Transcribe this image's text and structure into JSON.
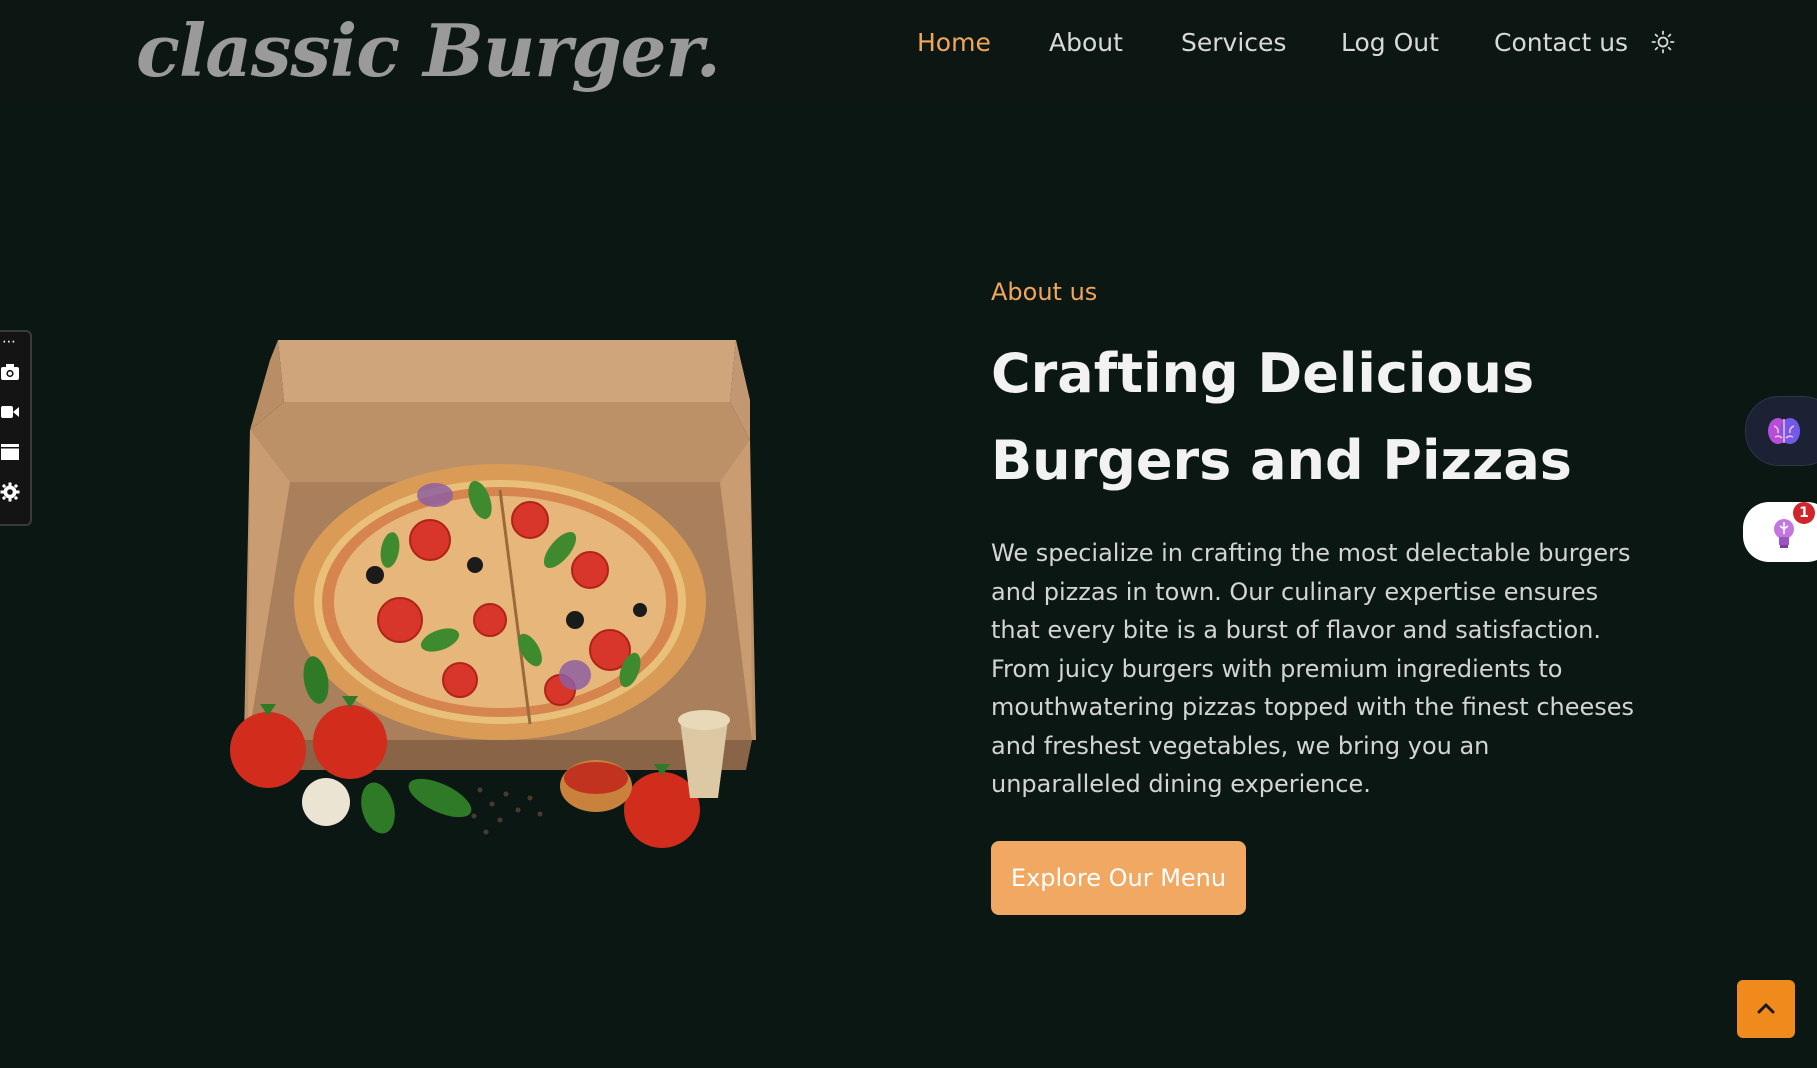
{
  "header": {
    "logo": "classic Burger.",
    "nav": [
      {
        "label": "Home",
        "active": true
      },
      {
        "label": "About",
        "active": false
      },
      {
        "label": "Services",
        "active": false
      },
      {
        "label": "Log Out",
        "active": false
      },
      {
        "label": "Contact us",
        "active": false
      }
    ],
    "theme_icon": "sun-icon"
  },
  "toolbar": {
    "overflow": "⋯",
    "icons": [
      "camera-icon",
      "video-icon",
      "window-icon",
      "gear-icon"
    ]
  },
  "hero": {
    "kicker": "About us",
    "headline_line1": "Crafting Delicious",
    "headline_line2": "Burgers and Pizzas",
    "paragraph": "We specialize in crafting the most delectable burgers and pizzas in town. Our culinary expertise ensures that every bite is a burst of flavor and satisfaction. From juicy burgers with premium ingredients to mouthwatering pizzas topped with the finest cheeses and freshest vegetables, we bring you an unparalleled dining experience.",
    "cta_label": "Explore Our Menu"
  },
  "widgets": {
    "brain_icon": "brain-icon",
    "idea_icon": "lightbulb-icon",
    "idea_badge": "1",
    "back_to_top_icon": "chevron-up-icon"
  },
  "colors": {
    "background": "#0a1713",
    "accent": "#f2a65a",
    "button": "#f0a862",
    "back_to_top": "#f08a1c"
  }
}
